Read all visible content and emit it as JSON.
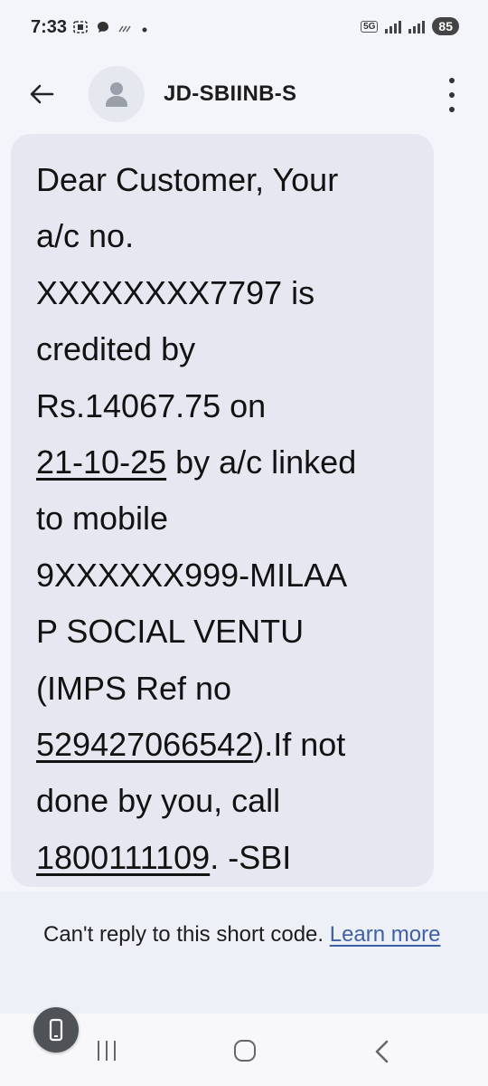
{
  "status_bar": {
    "time": "7:33",
    "network": "5G",
    "battery": "85"
  },
  "header": {
    "title": "JD-SBIINB-S",
    "back_icon": "arrow-left-icon",
    "menu_icon": "more-vertical-icon",
    "avatar_icon": "person-icon"
  },
  "message": {
    "lines": [
      "Dear Customer, Your",
      "a/c no.",
      "XXXXXXXX7797 is",
      "credited by",
      "Rs.14067.75 on"
    ],
    "date_link": "21-10-25",
    "date_suffix": " by a/c linked",
    "line_mobile": "to mobile",
    "line_masked": "9XXXXXX999-MILAA",
    "line_social": "P SOCIAL VENTU",
    "line_imps": "(IMPS Ref no",
    "ref_link": "529427066542",
    "ref_suffix": ").If not",
    "line_done": "done by you, call",
    "phone_link": "1800111109",
    "phone_suffix": ". -SBI"
  },
  "reply_note": {
    "text": "Can't reply to this short code. ",
    "link": "Learn more"
  },
  "colors": {
    "background": "#f4f5fb",
    "bubble": "#e6e7f1",
    "link": "#3f5fa8"
  }
}
